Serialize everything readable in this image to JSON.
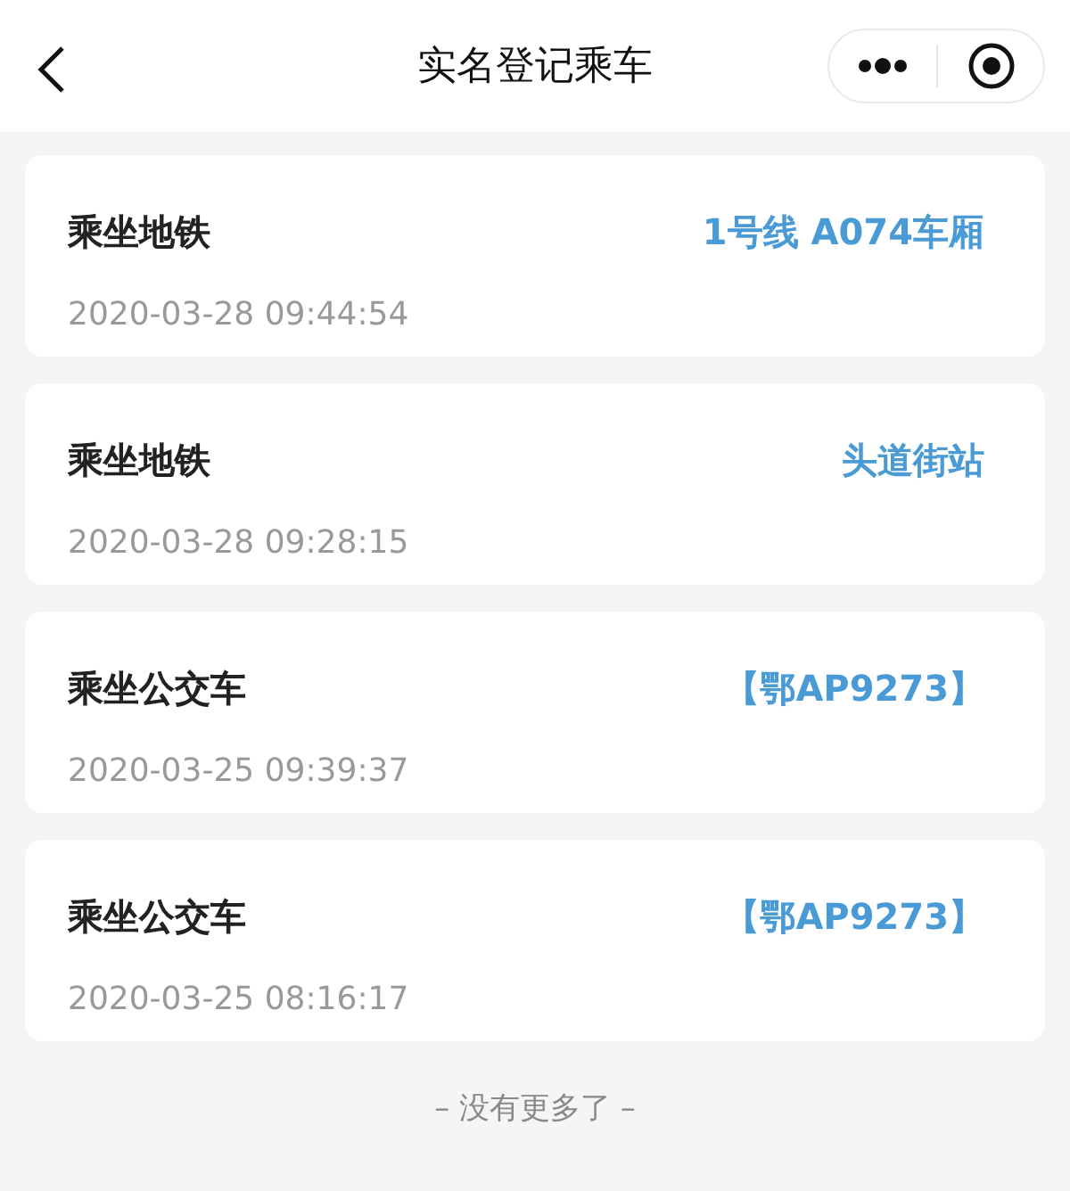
{
  "header": {
    "title": "实名登记乘车"
  },
  "records": [
    {
      "title": "乘坐地铁",
      "time": "2020-03-28 09:44:54",
      "detail": "1号线 A074车厢"
    },
    {
      "title": "乘坐地铁",
      "time": "2020-03-28 09:28:15",
      "detail": "头道街站"
    },
    {
      "title": "乘坐公交车",
      "time": "2020-03-25 09:39:37",
      "detail": "【鄂AP9273】"
    },
    {
      "title": "乘坐公交车",
      "time": "2020-03-25 08:16:17",
      "detail": "【鄂AP9273】"
    }
  ],
  "footer": "– 没有更多了 –"
}
